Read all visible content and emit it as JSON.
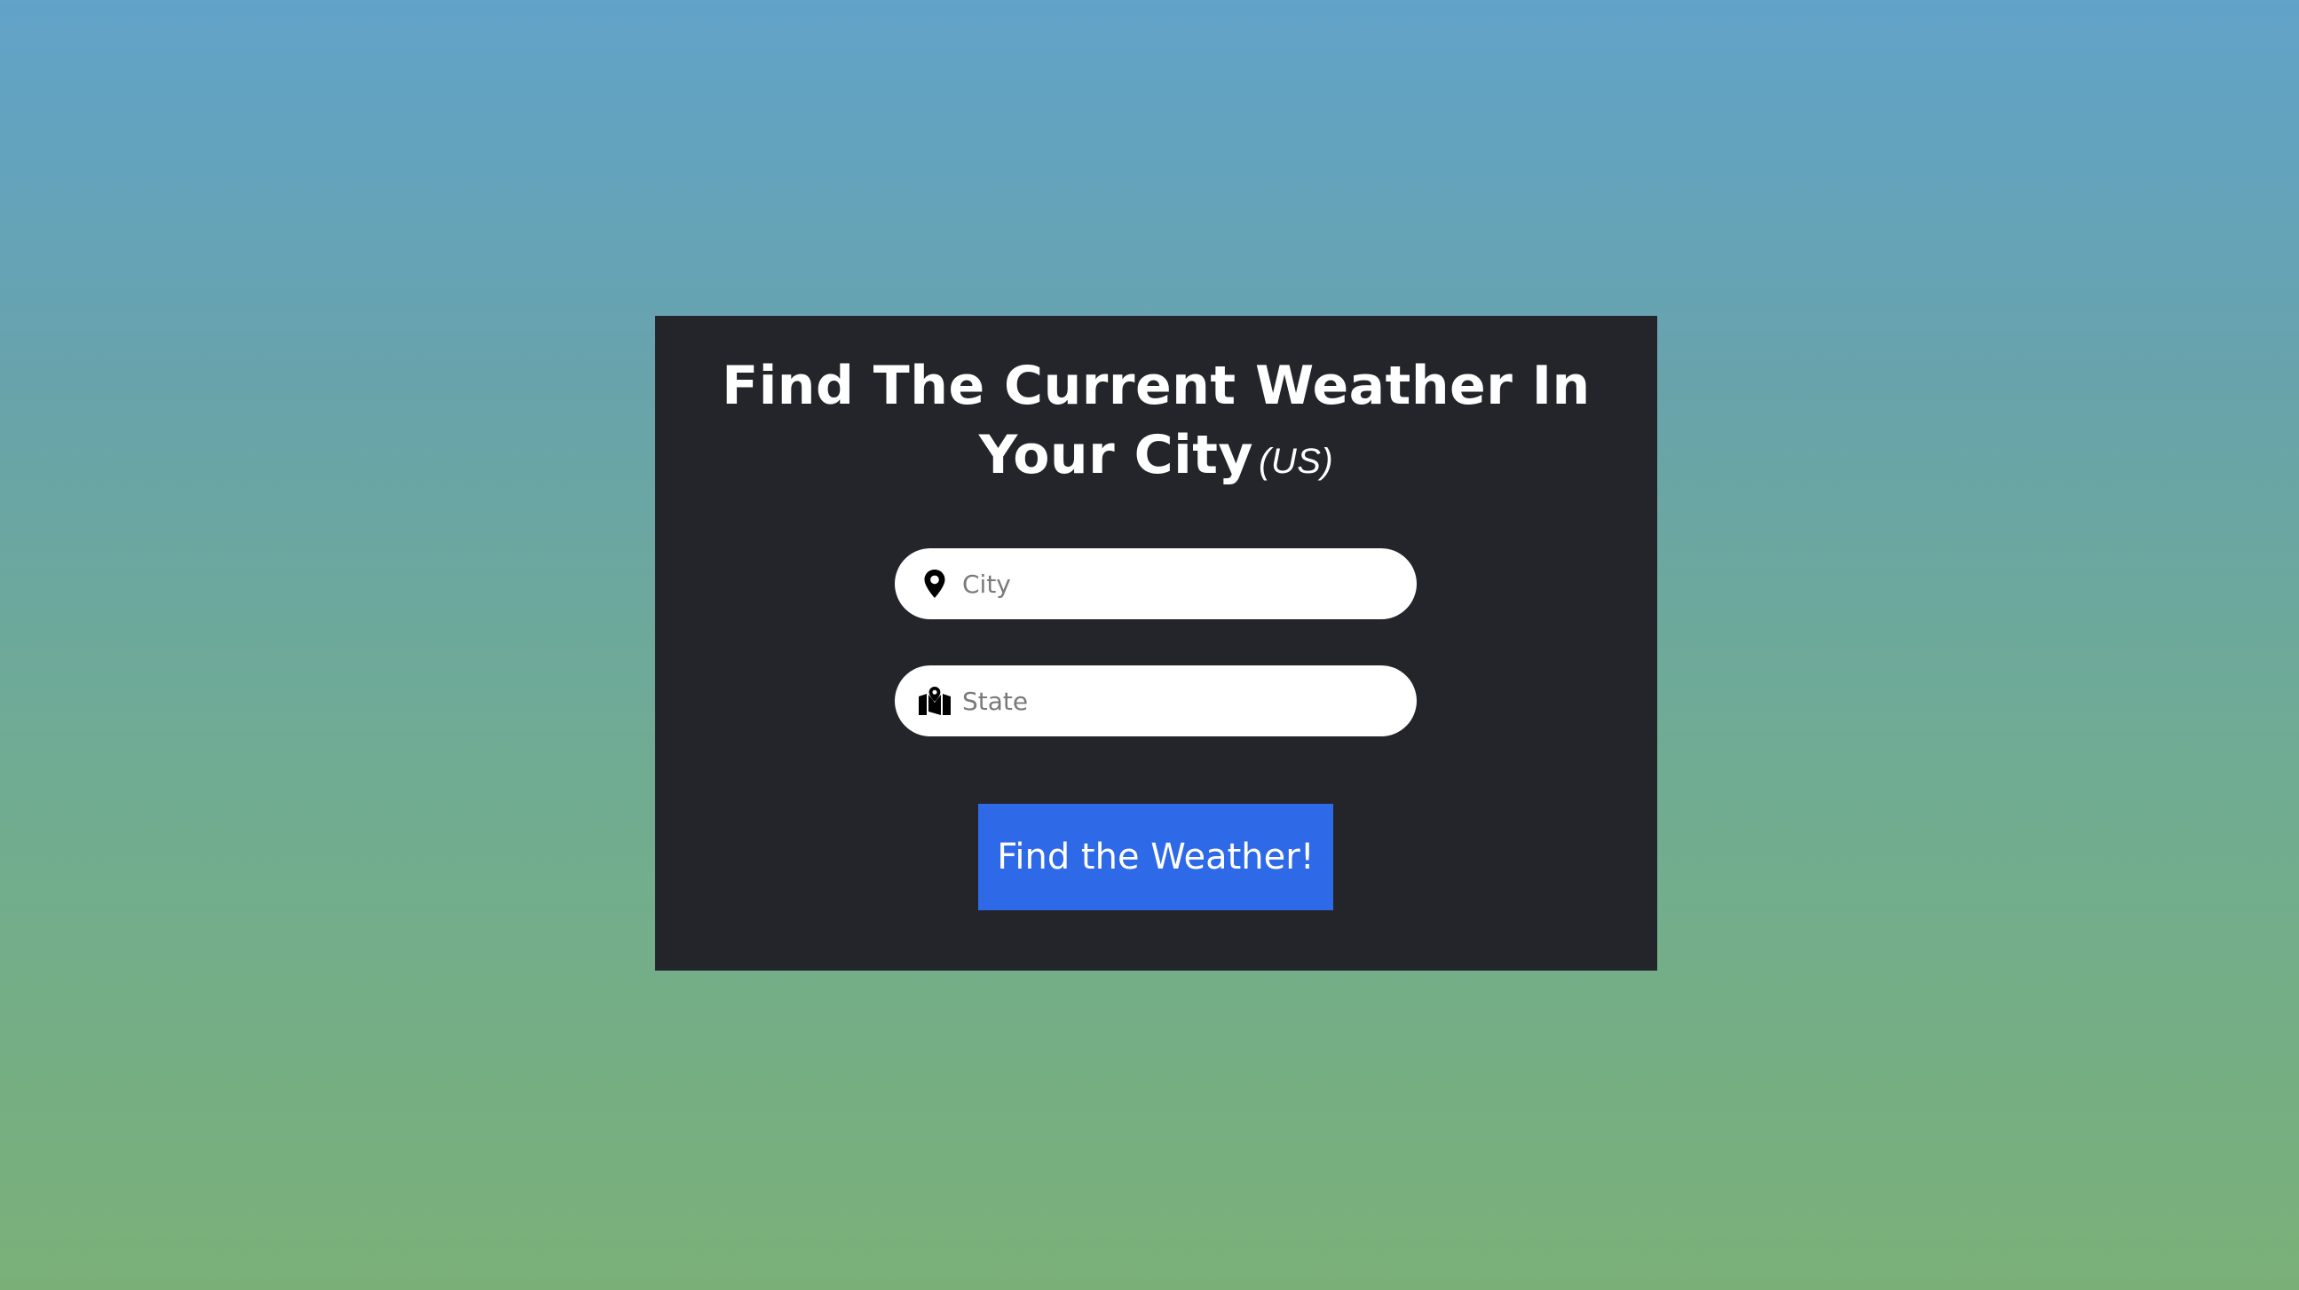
{
  "header": {
    "title_line1": "Find The Current Weather In",
    "title_line2": "Your City",
    "title_suffix": "(US)"
  },
  "form": {
    "city": {
      "placeholder": "City",
      "value": "",
      "icon": "map-pin-icon"
    },
    "state": {
      "placeholder": "State",
      "value": "",
      "icon": "map-icon"
    },
    "submit_label": "Find the Weather!"
  },
  "colors": {
    "card_background": "#24252b",
    "button_background": "#2e69e8",
    "gradient_top": "#61a3c9",
    "gradient_bottom": "#7ab078"
  }
}
